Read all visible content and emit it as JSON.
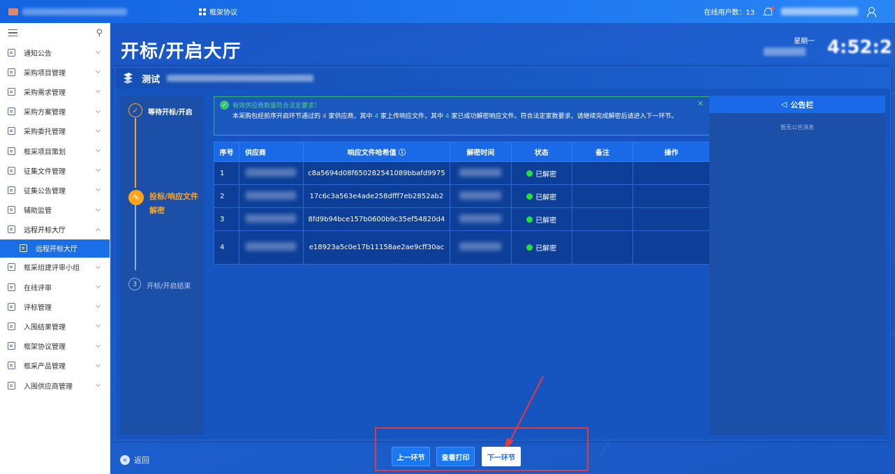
{
  "topbar": {
    "tab_label": "框架协议",
    "online_users": "在线用户数：13"
  },
  "sidebar": {
    "items": [
      {
        "label": "通知公告"
      },
      {
        "label": "采购项目管理"
      },
      {
        "label": "采购需求管理"
      },
      {
        "label": "采购方案管理"
      },
      {
        "label": "采购委托管理"
      },
      {
        "label": "框采项目策划"
      },
      {
        "label": "征集文件管理"
      },
      {
        "label": "征集公告管理"
      },
      {
        "label": "辅助监管"
      },
      {
        "label": "远程开标大厅"
      }
    ],
    "active_sub": "远程开标大厅",
    "items_after": [
      {
        "label": "框采组建评审小组"
      },
      {
        "label": "在线评审"
      },
      {
        "label": "评标管理"
      },
      {
        "label": "入围结果管理"
      },
      {
        "label": "框架协议管理"
      },
      {
        "label": "框采产品管理"
      },
      {
        "label": "入围供应商管理"
      }
    ]
  },
  "main": {
    "title": "开标/开启大厅",
    "weekday": "星期一",
    "time": "4:52:2",
    "panel_title": "测试",
    "steps": [
      {
        "label": "等待开标/开启",
        "state": "done"
      },
      {
        "label": "投标/响应文件解密",
        "state": "active"
      },
      {
        "number": "3",
        "label": "开标/开启结束",
        "state": "pending"
      }
    ],
    "alert": {
      "title": "有效供应商数量符合法定要求！",
      "body_1": "本采购包经前序开启环节通过的",
      "count_passed": "4",
      "body_2": "家供应商，其中",
      "count_uploaded": "4",
      "body_3": "家上传响应文件，其中",
      "count_decrypted": "4",
      "body_4": "家已成功解密响应文件。符合法定家数要求，请继续完成解密后请进入下一环节。"
    },
    "table": {
      "headers": [
        "序号",
        "供应商",
        "响应文件哈希值",
        "解密时间",
        "状态",
        "备注",
        "操作"
      ],
      "rows": [
        {
          "no": "1",
          "hash": "c8a5694d08f650282541089bbafd9975",
          "status": "已解密"
        },
        {
          "no": "2",
          "hash": "17c6c3a563e4ade258dfff7eb2852ab2",
          "status": "已解密"
        },
        {
          "no": "3",
          "hash": "8fd9b94bce157b0600b9c35ef54820d4",
          "status": "已解密"
        },
        {
          "no": "4",
          "hash": "e18923a5c0e17b11158ae2ae9cff30ac",
          "status": "已解密"
        }
      ]
    },
    "notice": {
      "title": "公告栏",
      "empty": "暂无公告消息"
    },
    "back_label": "返回",
    "buttons": {
      "prev": "上一环节",
      "print": "查看打印",
      "next": "下一环节"
    }
  },
  "colors": {
    "primary": "#1a6ae8",
    "accent": "#ffa41b",
    "success": "#28e03a",
    "highlight_frame": "#e23b3b"
  }
}
